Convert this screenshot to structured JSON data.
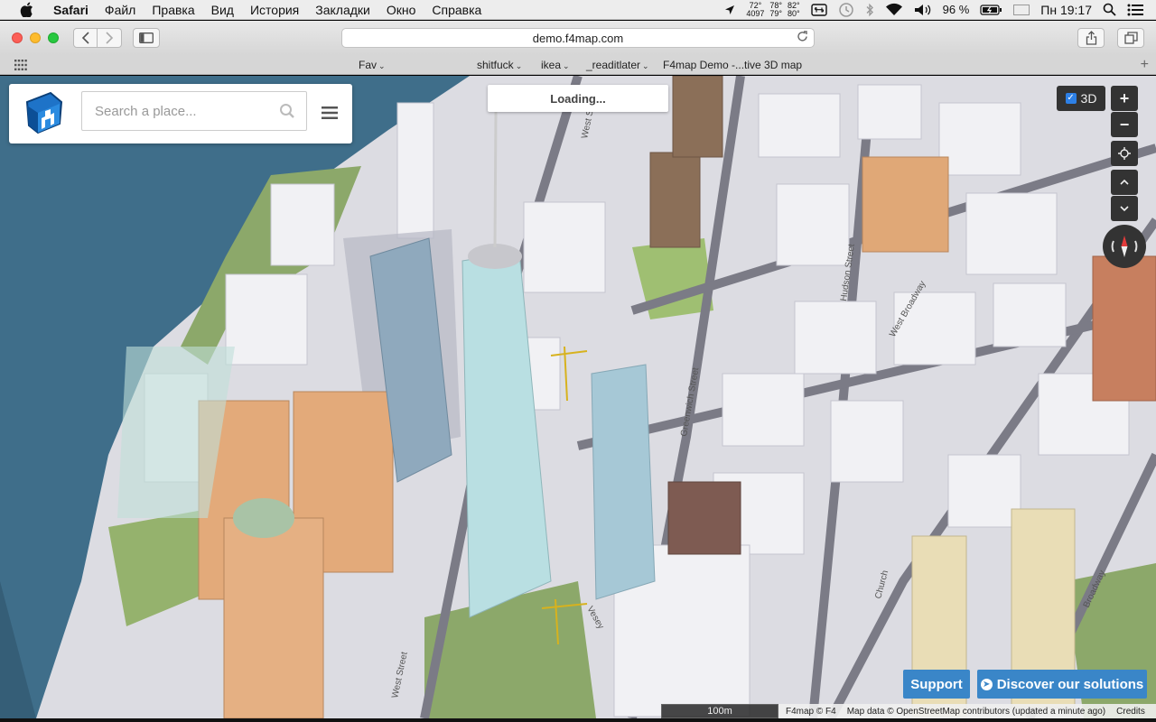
{
  "menubar": {
    "items": [
      "Safari",
      "Файл",
      "Правка",
      "Вид",
      "История",
      "Закладки",
      "Окно",
      "Справка"
    ],
    "temps": [
      {
        "top": "72°",
        "bottom": "4097"
      },
      {
        "top": "78°",
        "bottom": "79°"
      },
      {
        "top": "82°",
        "bottom": "80°"
      }
    ],
    "battery": "96 %",
    "clock": "Пн 19:17",
    "icons": [
      "apple-icon",
      "location-arrow-icon",
      "keyboard-shortcut-icon",
      "time-machine-icon",
      "bluetooth-icon",
      "wifi-icon",
      "volume-icon",
      "battery-icon",
      "flag-ru-icon",
      "spotlight-search-icon",
      "notification-center-icon"
    ]
  },
  "browser": {
    "url": "demo.f4map.com"
  },
  "bookmarks": {
    "items": [
      "Fav",
      "shitfuck",
      "ikea",
      "_readitlater"
    ],
    "tab_title": "F4map Demo -...tive 3D map"
  },
  "map": {
    "search_placeholder": "Search a place...",
    "loading": "Loading...",
    "toggle_3d": "3D",
    "support": "Support",
    "discover": "Discover our solutions",
    "scale": "100m",
    "attribution": {
      "f4": "F4map © F4",
      "osm": "Map data © OpenStreetMap contributors (updated a minute ago)",
      "credits": "Credits"
    },
    "street_labels": [
      "West Street",
      "West Street",
      "Vesey",
      "Greenwich Street",
      "Church",
      "Broadway",
      "West Broadway",
      "Hudson Street"
    ],
    "colors": {
      "water": "#3f6e8a",
      "accent_button": "#3a86c8",
      "control_dark": "#333333"
    }
  }
}
